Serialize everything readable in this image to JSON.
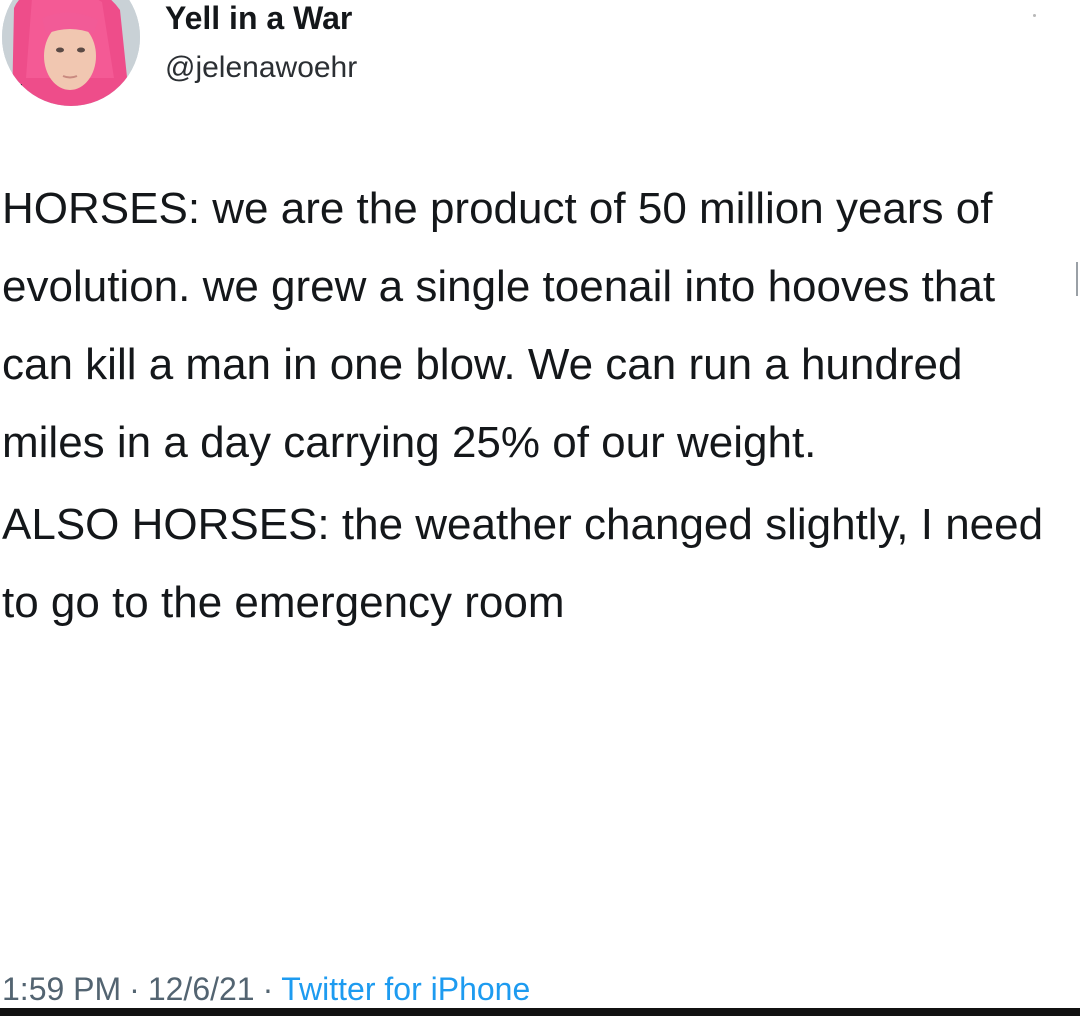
{
  "tweet": {
    "author": {
      "display_name": "Yell in a War",
      "handle": "@jelenawoehr",
      "avatar_icon": "profile-photo-avatar"
    },
    "paragraphs": [
      "HORSES: we are the product of 50 million years of evolution. we grew a single toenail into hooves that can kill a man in one blow. We can run a hundred miles in a day carrying 25% of our weight.",
      "ALSO HORSES: the weather changed slightly, I need to go to the emergency room"
    ],
    "meta": {
      "time": "1:59 PM",
      "date": "12/6/21",
      "separator": "·",
      "source": "Twitter for iPhone"
    }
  },
  "colors": {
    "text": "#14171a",
    "secondary": "#536471",
    "link": "#1d9bf0",
    "background": "#ffffff"
  }
}
